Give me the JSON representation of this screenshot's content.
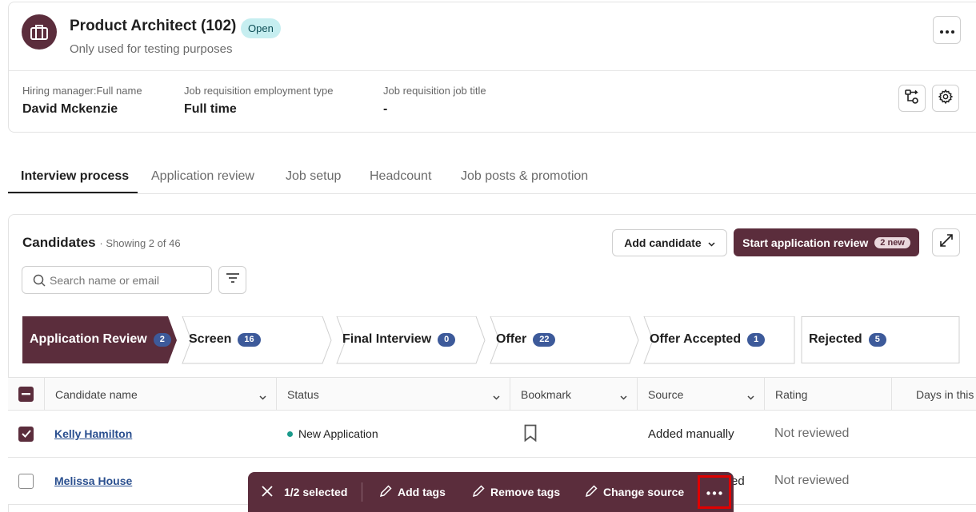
{
  "header": {
    "title": "Product Architect (102)",
    "status_badge": "Open",
    "subtitle": "Only used for testing purposes",
    "meta": [
      {
        "label": "Hiring manager:Full name",
        "value": "David Mckenzie"
      },
      {
        "label": "Job requisition employment type",
        "value": "Full time"
      },
      {
        "label": "Job requisition job title",
        "value": "-"
      }
    ]
  },
  "tabs": [
    {
      "label": "Interview process",
      "active": true
    },
    {
      "label": "Application review",
      "active": false
    },
    {
      "label": "Job setup",
      "active": false
    },
    {
      "label": "Headcount",
      "active": false
    },
    {
      "label": "Job posts & promotion",
      "active": false
    }
  ],
  "candidates": {
    "title": "Candidates",
    "count_text": "· Showing 2 of 46",
    "add_candidate_label": "Add candidate",
    "start_review_label": "Start application review",
    "start_review_badge": "2 new",
    "search_placeholder": "Search name or email"
  },
  "stages": [
    {
      "label": "Application Review",
      "count": "2",
      "active": true
    },
    {
      "label": "Screen",
      "count": "16",
      "active": false
    },
    {
      "label": "Final Interview",
      "count": "0",
      "active": false
    },
    {
      "label": "Offer",
      "count": "22",
      "active": false
    },
    {
      "label": "Offer Accepted",
      "count": "1",
      "active": false
    },
    {
      "label": "Rejected",
      "count": "5",
      "active": false
    }
  ],
  "table": {
    "columns": [
      "Candidate name",
      "Status",
      "Bookmark",
      "Source",
      "Rating",
      "Days in this"
    ],
    "rows": [
      {
        "name": "Kelly Hamilton",
        "status": "New Application",
        "source": "Added manually",
        "rating": "Not reviewed",
        "checked": true
      },
      {
        "name": "Melissa House",
        "status": "",
        "source": "ed",
        "rating": "Not reviewed",
        "checked": false
      }
    ]
  },
  "action_bar": {
    "selected_text": "1/2 selected",
    "add_tags": "Add tags",
    "remove_tags": "Remove tags",
    "change_source": "Change source"
  },
  "colors": {
    "brand": "#5b2d3c",
    "badge_blue": "#3d5a9a",
    "open_badge_bg": "#c6eef0",
    "status_dot": "#1a9a8b",
    "highlight": "#e00000"
  }
}
